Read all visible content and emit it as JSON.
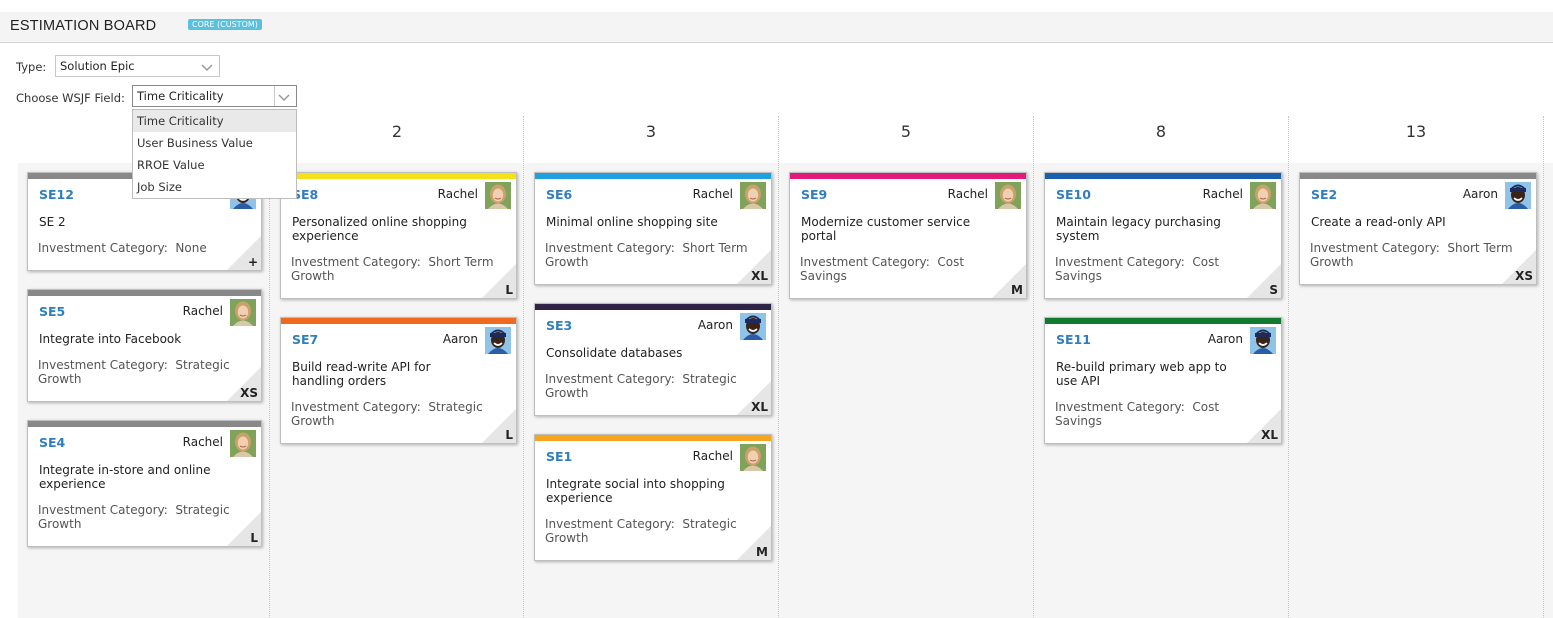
{
  "header": {
    "title": "ESTIMATION BOARD",
    "badge": "CORE (CUSTOM)"
  },
  "filters": {
    "type_label": "Type:",
    "type_value": "Solution Epic",
    "wsjf_label": "Choose WSJF Field:",
    "wsjf_value": "Time Criticality",
    "wsjf_options": [
      "Time Criticality",
      "User Business Value",
      "RROE Value",
      "Job Size"
    ]
  },
  "columns": [
    "2",
    "3",
    "5",
    "8",
    "13"
  ],
  "investment_label": "Investment Category:",
  "cards": [
    {
      "id": "SE12",
      "owner": "",
      "avatar": "aaron",
      "title": "SE 2",
      "investment": "None",
      "size": "+",
      "color": "#888888"
    },
    {
      "id": "SE5",
      "owner": "Rachel",
      "avatar": "rachel",
      "title": "Integrate into Facebook",
      "investment": "Strategic Growth",
      "size": "XS",
      "color": "#888888"
    },
    {
      "id": "SE4",
      "owner": "Rachel",
      "avatar": "rachel",
      "title": "Integrate in-store and online experience",
      "investment": "Strategic Growth",
      "size": "L",
      "color": "#888888"
    },
    {
      "id": "SE8",
      "owner": "Rachel",
      "avatar": "rachel",
      "title": "Personalized online shopping experience",
      "investment": "Short Term Growth",
      "size": "L",
      "color": "#f5e11a"
    },
    {
      "id": "SE7",
      "owner": "Aaron",
      "avatar": "aaron",
      "title": "Build read-write API for handling orders",
      "investment": "Strategic Growth",
      "size": "L",
      "color": "#ee6a1e"
    },
    {
      "id": "SE6",
      "owner": "Rachel",
      "avatar": "rachel",
      "title": "Minimal online shopping site",
      "investment": "Short Term Growth",
      "size": "XL",
      "color": "#21a0df"
    },
    {
      "id": "SE3",
      "owner": "Aaron",
      "avatar": "aaron",
      "title": "Consolidate databases",
      "investment": "Strategic Growth",
      "size": "XL",
      "color": "#2e2347"
    },
    {
      "id": "SE1",
      "owner": "Rachel",
      "avatar": "rachel",
      "title": "Integrate social into shopping experience",
      "investment": "Strategic Growth",
      "size": "M",
      "color": "#f7a51c"
    },
    {
      "id": "SE9",
      "owner": "Rachel",
      "avatar": "rachel",
      "title": "Modernize customer service portal",
      "investment": "Cost Savings",
      "size": "M",
      "color": "#e21a7c"
    },
    {
      "id": "SE10",
      "owner": "Rachel",
      "avatar": "rachel",
      "title": "Maintain legacy purchasing system",
      "investment": "Cost Savings",
      "size": "S",
      "color": "#1a5fae"
    },
    {
      "id": "SE11",
      "owner": "Aaron",
      "avatar": "aaron",
      "title": "Re-build primary web app to use API",
      "investment": "Cost Savings",
      "size": "XL",
      "color": "#117a2e"
    },
    {
      "id": "SE2",
      "owner": "Aaron",
      "avatar": "aaron",
      "title": "Create a read-only API",
      "investment": "Short Term Growth",
      "size": "XS",
      "color": "#888888"
    }
  ]
}
